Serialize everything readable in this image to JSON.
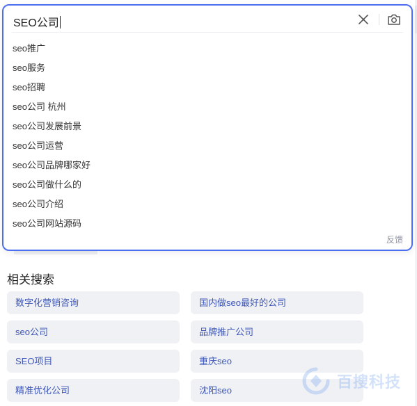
{
  "search": {
    "query": "SEO公司",
    "close_icon": "close-icon",
    "camera_icon": "camera-icon",
    "suggestions": [
      "seo推广",
      "seo服务",
      "seo招聘",
      "seo公司 杭州",
      "seo公司发展前景",
      "seo公司运营",
      "seo公司品牌哪家好",
      "seo公司做什么的",
      "seo公司介绍",
      "seo公司网站源码"
    ],
    "feedback_label": "反馈"
  },
  "related": {
    "title": "相关搜索",
    "items": [
      "数字化营销咨询",
      "国内做seo最好的公司",
      "seo公司",
      "品牌推广公司",
      "SEO项目",
      "重庆seo",
      "精准优化公司",
      "沈阳seo"
    ]
  },
  "watermark": {
    "text": "百搜科技",
    "color": "#3d7ee8"
  },
  "colors": {
    "accent": "#4e6ef2",
    "chip_bg": "#f0f1f5",
    "chip_text": "#3d56b8"
  }
}
